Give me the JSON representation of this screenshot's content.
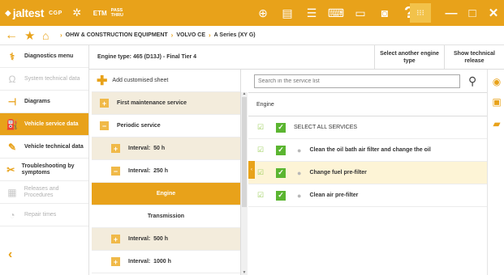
{
  "app": {
    "logo_glyph": "◆",
    "logo": "jaltest",
    "mode": "CGP",
    "etm": "ETM",
    "etm_line1": "PASS",
    "etm_line2": "THRU"
  },
  "toolbar_icons": [
    "globe-icon",
    "document-icon",
    "list-icon",
    "keyboard-icon",
    "truck-icon",
    "camera-icon",
    "help-icon"
  ],
  "window_controls": {
    "minimize": "—",
    "maximize": "□",
    "close": "✕"
  },
  "breadcrumb": {
    "items": [
      "OHW & CONSTRUCTION EQUIPMENT",
      "VOLVO CE",
      "A Series (XY G)"
    ]
  },
  "sidebar": {
    "items": [
      {
        "label": "Diagnostics menu",
        "state": "normal"
      },
      {
        "label": "System technical data",
        "state": "dim"
      },
      {
        "label": "Diagrams",
        "state": "normal"
      },
      {
        "label": "Vehicle service data",
        "state": "active"
      },
      {
        "label": "Vehicle technical data",
        "state": "normal"
      },
      {
        "label": "Troubleshooting by symptoms",
        "state": "normal"
      },
      {
        "label": "Releases and Procedures",
        "state": "dim"
      },
      {
        "label": "Repair times",
        "state": "dim"
      }
    ]
  },
  "engine": {
    "type_label": "Engine type:",
    "type_value": "465 (D13J) - Final Tier 4",
    "select_another": "Select another engine type",
    "show_release": "Show technical release"
  },
  "tree": {
    "add_label": "Add customised sheet",
    "first_maintenance": "First maintenance service",
    "periodic": "Periodic service",
    "interval_label": "Interval:",
    "intervals": [
      "50 h",
      "250 h",
      "500 h",
      "1000 h"
    ],
    "engine": "Engine",
    "transmission": "Transmission"
  },
  "search": {
    "placeholder": "Search in the service list"
  },
  "services": {
    "header": "Engine",
    "select_all": "SELECT ALL SERVICES",
    "items": [
      "Clean the oil bath air filter and change the oil",
      "Change fuel pre-filter",
      "Clean air pre-filter"
    ]
  },
  "colors": {
    "accent": "#e8a21a",
    "check_green": "#5bb531",
    "selected_row": "#fdf4d6"
  }
}
